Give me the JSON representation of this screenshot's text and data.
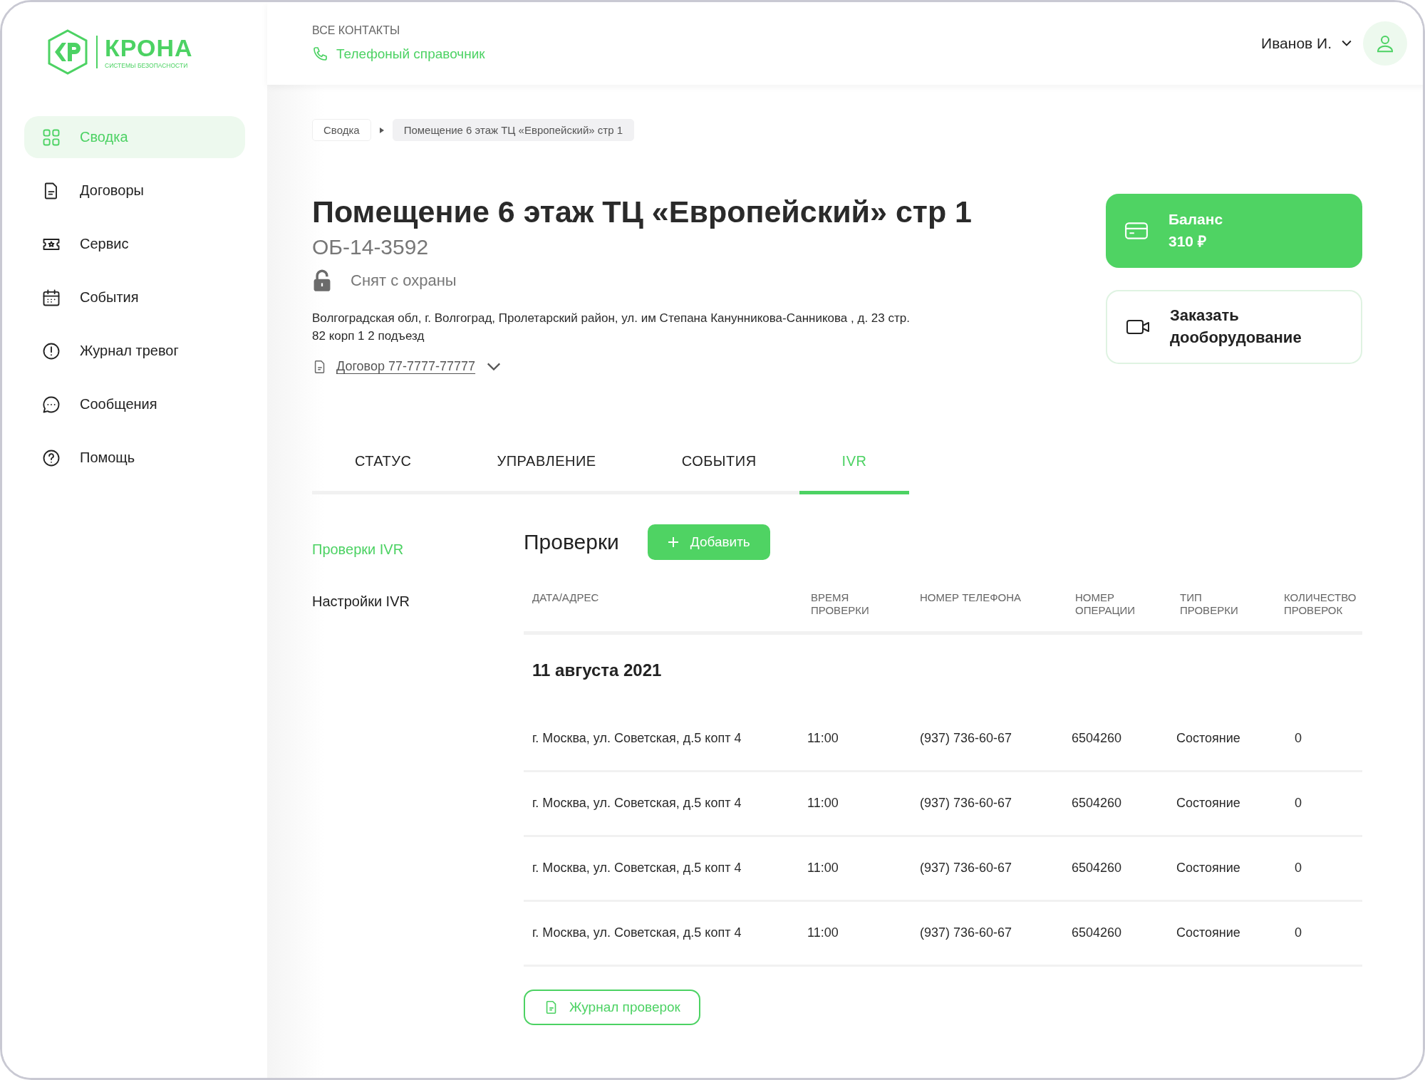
{
  "logo": {
    "name": "КРОНА",
    "tagline": "СИСТЕМЫ БЕЗОПАСНОСТИ"
  },
  "sidebar": {
    "items": [
      {
        "label": "Сводка",
        "selected": true
      },
      {
        "label": "Договоры",
        "selected": false
      },
      {
        "label": "Сервис",
        "selected": false
      },
      {
        "label": "События",
        "selected": false
      },
      {
        "label": "Журнал тревог",
        "selected": false
      },
      {
        "label": "Сообщения",
        "selected": false
      },
      {
        "label": "Помощь",
        "selected": false
      }
    ]
  },
  "header": {
    "contacts_label": "ВСЕ КОНТАКТЫ",
    "phonebook_link": "Телефоный справочник",
    "user": "Иванов И."
  },
  "breadcrumbs": [
    "Сводка",
    "Помещение 6 этаж ТЦ «Европейский» стр 1"
  ],
  "object": {
    "title": "Помещение 6 этаж ТЦ «Европейский» стр 1",
    "code": "ОБ-14-3592",
    "status": "Снят с охраны",
    "armed": false,
    "address": "Волгоградская обл, г. Волгоград, Пролетарский район, ул. им Степана Канунникова-Санникова , д. 23 стр. 82 корп 1 2 подъезд",
    "contract": "Договор 77-7777-77777"
  },
  "balance": {
    "label": "Баланс",
    "amount": "310 ₽"
  },
  "order_button": "Заказать дооборудование",
  "tabs": [
    {
      "label": "СТАТУС",
      "selected": false
    },
    {
      "label": "УПРАВЛЕНИЕ",
      "selected": false
    },
    {
      "label": "СОБЫТИЯ",
      "selected": false
    },
    {
      "label": "IVR",
      "selected": true
    }
  ],
  "subnav": [
    {
      "label": "Проверки IVR",
      "selected": true
    },
    {
      "label": "Настройки IVR",
      "selected": false
    }
  ],
  "checks": {
    "title": "Проверки",
    "add_button": "Добавить",
    "columns": [
      "ДАТА/АДРЕС",
      "ВРЕМЯ ПРОВЕРКИ",
      "НОМЕР ТЕЛЕФОНА",
      "НОМЕР ОПЕРАЦИИ",
      "ТИП ПРОВЕРКИ",
      "КОЛИЧЕСТВО ПРОВЕРОК"
    ],
    "group": "11 августа 2021",
    "rows": [
      [
        "г. Москва, ул. Советская, д.5 копт 4",
        "11:00",
        "(937) 736-60-67",
        "6504260",
        "Состояние",
        "0"
      ],
      [
        "г. Москва, ул. Советская, д.5 копт 4",
        "11:00",
        "(937) 736-60-67",
        "6504260",
        "Состояние",
        "0"
      ],
      [
        "г. Москва, ул. Советская, д.5 копт 4",
        "11:00",
        "(937) 736-60-67",
        "6504260",
        "Состояние",
        "0"
      ],
      [
        "г. Москва, ул. Советская, д.5 копт 4",
        "11:00",
        "(937) 736-60-67",
        "6504260",
        "Состояние",
        "0"
      ]
    ],
    "journal_button": "Журнал проверок"
  }
}
